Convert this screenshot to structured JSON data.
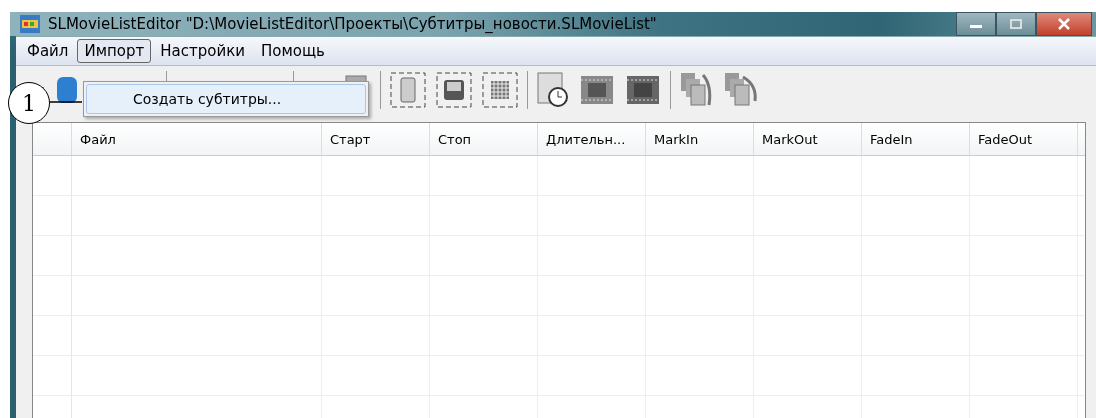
{
  "window": {
    "title": "SLMovieListEditor \"D:\\MovieListEditor\\Проекты\\Субтитры_новости.SLMovieList\""
  },
  "menu": [
    {
      "label": "Файл",
      "selected": false
    },
    {
      "label": "Импорт",
      "selected": true
    },
    {
      "label": "Настройки",
      "selected": false
    },
    {
      "label": "Помощь",
      "selected": false
    }
  ],
  "dropdown": {
    "items": [
      {
        "label": "Создать субтитры...",
        "selected": true
      }
    ]
  },
  "callout": {
    "label": "1"
  },
  "table": {
    "columns": [
      "Файл",
      "Старт",
      "Стоп",
      "Длительн...",
      "MarkIn",
      "MarkOut",
      "FadeIn",
      "FadeOut"
    ]
  }
}
